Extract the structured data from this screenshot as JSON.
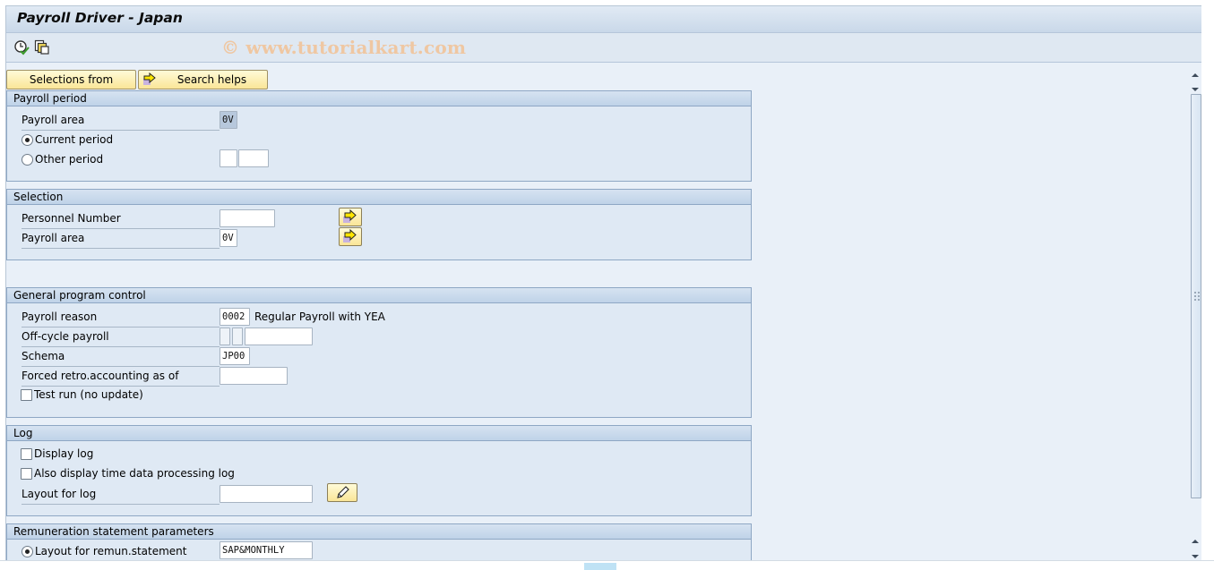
{
  "window": {
    "title": "Payroll Driver - Japan"
  },
  "toolbar": {
    "icons": [
      {
        "name": "execute-background-icon",
        "glyph": "clock-check"
      },
      {
        "name": "get-variant-icon",
        "glyph": "stacked-docs"
      }
    ],
    "watermark": "© www.tutorialkart.com"
  },
  "action_buttons": {
    "selections_from": "Selections from",
    "search_helps": "Search helps"
  },
  "groups": {
    "payroll_period": {
      "title": "Payroll period",
      "payroll_area_label": "Payroll area",
      "payroll_area_value": "0V",
      "current_period_label": "Current period",
      "current_period_selected": true,
      "other_period_label": "Other period",
      "other_period_selected": false,
      "other_period_value_1": "",
      "other_period_value_2": ""
    },
    "selection": {
      "title": "Selection",
      "personnel_number_label": "Personnel Number",
      "personnel_number_value": "",
      "payroll_area_label": "Payroll area",
      "payroll_area_value": "0V"
    },
    "general_program_control": {
      "title": "General program control",
      "payroll_reason_label": "Payroll reason",
      "payroll_reason_value": "0002",
      "payroll_reason_desc": "Regular Payroll with YEA",
      "off_cycle_label": "Off-cycle payroll",
      "off_cycle_value_1": "",
      "off_cycle_value_2": "",
      "off_cycle_value_3": "",
      "schema_label": "Schema",
      "schema_value": "JP00",
      "forced_retro_label": "Forced retro.accounting as of",
      "forced_retro_value": "",
      "test_run_label": "Test run (no update)",
      "test_run_checked": false
    },
    "log": {
      "title": "Log",
      "display_log_label": "Display log",
      "display_log_checked": false,
      "time_log_label": "Also display time data processing log",
      "time_log_checked": false,
      "layout_label": "Layout for log",
      "layout_value": ""
    },
    "remuneration": {
      "title": "Remuneration statement parameters",
      "layout_label": "Layout for remun.statement",
      "layout_selected": true,
      "layout_value": "SAP&MONTHLY"
    }
  },
  "colors": {
    "button_yellow": "#fae597",
    "group_header": "#bfd3e8",
    "background": "#e9f0f8"
  }
}
